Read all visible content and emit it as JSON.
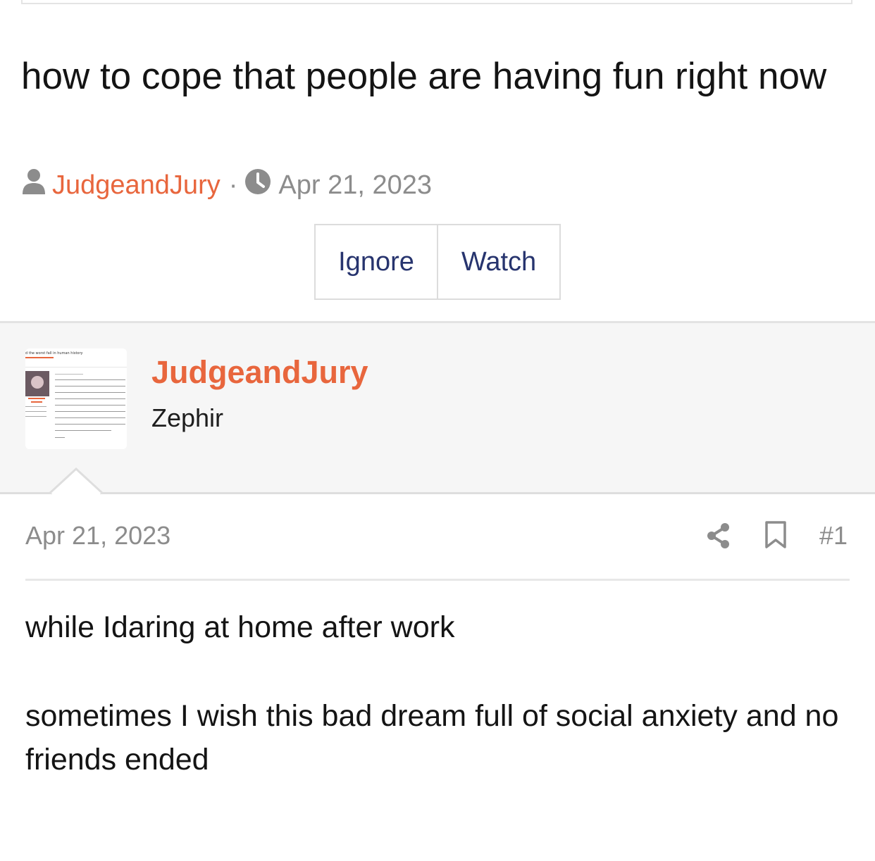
{
  "thread": {
    "title": "how to cope that people are having fun right now",
    "author": "JudgeandJury",
    "separator": "·",
    "date": "Apr 21, 2023",
    "author_icon": "user-icon",
    "date_icon": "clock-icon"
  },
  "actions": {
    "ignore_label": "Ignore",
    "watch_label": "Watch"
  },
  "user": {
    "name": "JudgeandJury",
    "title": "Zephir",
    "avatar_icon": "avatar-screenshot-thumbnail",
    "avatar_lettering": "d the worst fall in human history"
  },
  "post": {
    "date": "Apr 21, 2023",
    "number": "#1",
    "share_icon": "share-icon",
    "bookmark_icon": "bookmark-icon",
    "paragraphs": [
      "while Idaring at home after work",
      "sometimes I wish this bad dream full of social anxiety and no friends ended"
    ]
  },
  "colors": {
    "accent": "#e8663d",
    "button_text": "#27346e",
    "meta_gray": "#8c8c8c",
    "panel_bg": "#f6f6f6"
  }
}
